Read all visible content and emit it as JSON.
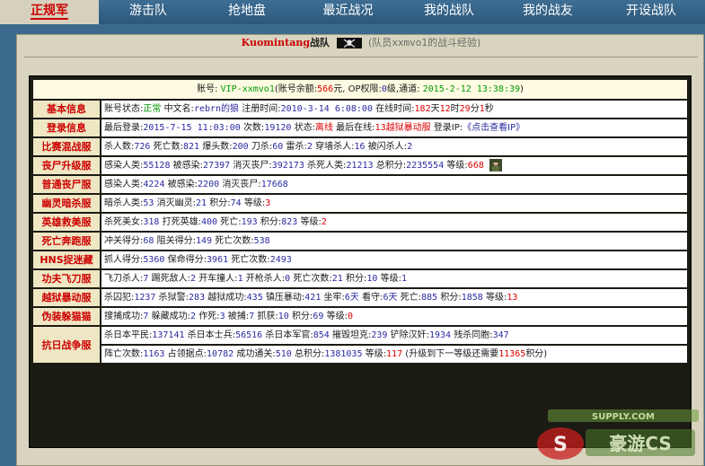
{
  "nav": {
    "items": [
      {
        "label": "正规军",
        "active": true
      },
      {
        "label": "游击队",
        "active": false
      },
      {
        "label": "抢地盘",
        "active": false
      },
      {
        "label": "最近战况",
        "active": false
      },
      {
        "label": "我的战队",
        "active": false
      },
      {
        "label": "我的战友",
        "active": false
      },
      {
        "label": "开设战队",
        "active": false
      }
    ]
  },
  "header": {
    "clan_name": "Kuomintang",
    "clan_suffix": "战队",
    "flag_icon": "skull-flag-icon",
    "member_prefix": "(队员",
    "member_name": "xxmvo1",
    "member_suffix": "的战斗经验)"
  },
  "account": {
    "label": "账号:",
    "id": "VIP-xxmvo1",
    "balance_label": "(账号余额:",
    "balance": "566",
    "balance_unit": "元,",
    "op_label": "OP权限:",
    "op_level": "0",
    "op_unit": "级,通道:",
    "datetime": "2015-2-12 13:38:39",
    "close": ")"
  },
  "rows": {
    "basic": {
      "title": "基本信息",
      "status_label": "账号状态:",
      "status": "正常",
      "cn_name_label": "中文名:",
      "cn_name": "rebrn的狼",
      "reg_label": "注册时间:",
      "reg_time": "2010-3-14 6:08:00",
      "online_label": "在线时间:",
      "days": "182",
      "days_unit": "天",
      "hours": "12",
      "hours_unit": "时",
      "mins": "29",
      "mins_unit": "分",
      "secs": "1",
      "secs_unit": "秒"
    },
    "login": {
      "title": "登录信息",
      "last_login_label": "最后登录:",
      "last_login": "2015-7-15 11:03:00",
      "count_label": "次数:",
      "count": "19120",
      "state_label": "状态:",
      "state": "离线",
      "last_online_label": "最后在线:",
      "last_online": "13越狱暴动服",
      "ip_label": "登录IP:",
      "ip_link": "《点击查看IP》"
    },
    "mix": {
      "title": "比赛混战服",
      "kills_label": "杀人数:",
      "kills": "726",
      "deaths_label": "死亡数:",
      "deaths": "821",
      "hs_label": "爆头数:",
      "hs": "200",
      "knife_label": "刀杀:",
      "knife": "60",
      "grenade_label": "雷杀:",
      "grenade": "2",
      "wall_label": "穿墙杀人:",
      "wall": "16",
      "flash_label": "被闪杀人:",
      "flash": "2"
    },
    "zombie_up": {
      "title": "丧尸升级服",
      "infect_label": "感染人类:",
      "infect": "55128",
      "infected_label": "被感染:",
      "infected": "27397",
      "destroy_label": "消灭丧尸:",
      "destroy": "392173",
      "killhuman_label": "杀死人类:",
      "killhuman": "21213",
      "score_label": "总积分:",
      "score": "2235554",
      "level_label": "等级:",
      "level": "668",
      "rank_icon": "soldier-rank-icon"
    },
    "zombie_normal": {
      "title": "普通丧尸服",
      "infect_label": "感染人类:",
      "infect": "4224",
      "infected_label": "被感染:",
      "infected": "2200",
      "destroy_label": "消灭丧尸:",
      "destroy": "17668"
    },
    "ghost": {
      "title": "幽灵暗杀服",
      "assassin_label": "暗杀人类:",
      "assassin": "53",
      "killghost_label": "消灭幽灵:",
      "killghost": "21",
      "score_label": "积分:",
      "score": "74",
      "level_label": "等级:",
      "level": "3"
    },
    "hero": {
      "title": "英雄救美服",
      "kill_beauty_label": "杀死美女:",
      "kill_beauty": "318",
      "kill_hero_label": "打死英雄:",
      "kill_hero": "400",
      "death_label": "死亡:",
      "death": "193",
      "score_label": "积分:",
      "score": "823",
      "level_label": "等级:",
      "level": "2"
    },
    "death_run": {
      "title": "死亡奔跑服",
      "rush_label": "冲关得分:",
      "rush": "68",
      "block_label": "阻关得分:",
      "block": "149",
      "death_label": "死亡次数:",
      "death": "538"
    },
    "hns": {
      "title": "HNS捉迷藏",
      "catch_label": "抓人得分:",
      "catch": "5360",
      "save_label": "保命得分:",
      "save": "3961",
      "death_label": "死亡次数:",
      "death": "2493"
    },
    "kungfu": {
      "title": "功夫飞刀服",
      "knife_label": "飞刀杀人:",
      "knife": "7",
      "kick_label": "踢死敌人:",
      "kick": "2",
      "car_label": "开车撞人:",
      "car": "1",
      "gun_label": "开枪杀人:",
      "gun": "0",
      "death_label": "死亡次数:",
      "death": "21",
      "score_label": "积分:",
      "score": "10",
      "level_label": "等级:",
      "level": "1"
    },
    "jail": {
      "title": "越狱暴动服",
      "kill_prisoner_label": "杀囚犯:",
      "kill_prisoner": "1237",
      "kill_guard_label": "杀狱警:",
      "kill_guard": "283",
      "escape_label": "越狱成功:",
      "escape": "435",
      "suppress_label": "镇压暴动:",
      "suppress": "421",
      "jail_label": "坐牢:",
      "jail_days": "6天",
      "guard_label": "看守:",
      "guard_days": "6天",
      "death_label": "死亡:",
      "death": "885",
      "score_label": "积分:",
      "score": "1858",
      "level_label": "等级:",
      "level": "13"
    },
    "camo": {
      "title": "伪装躲猫猫",
      "catch_label": "搜捕成功:",
      "catch": "7",
      "hide_label": "躲藏成功:",
      "hide": "2",
      "act_label": "作死:",
      "act": "3",
      "caught_label": "被捕:",
      "caught": "7",
      "grab_label": "抓获:",
      "grab": "10",
      "score_label": "积分:",
      "score": "69",
      "level_label": "等级:",
      "level": "0"
    },
    "war": {
      "title": "抗日战争服",
      "civ_label": "杀日本平民:",
      "civ": "137141",
      "soldier_label": "杀日本士兵:",
      "soldier": "56516",
      "officer_label": "杀日本军官:",
      "officer": "854",
      "tank_label": "摧毁坦克:",
      "tank": "239",
      "traitor_label": "铲除汉奸:",
      "traitor": "1934",
      "ally_label": "残杀同胞:",
      "ally": "347",
      "death_label": "阵亡次数:",
      "death": "1163",
      "capture_label": "占领据点:",
      "capture": "10782",
      "pass_label": "成功通关:",
      "pass": "510",
      "score_label": "总积分:",
      "score": "1381035",
      "level_label": "等级:",
      "level": "117",
      "next_prefix": "(升级到下一等级还需要",
      "next_value": "11365",
      "next_suffix": "积分)"
    }
  },
  "watermark": {
    "top_text": "SUPPLY.COM",
    "main_text": "豪游CS"
  },
  "colors": {
    "nav_bg": "#3e6e94",
    "panel_bg": "#d9d4bf",
    "accent_red": "#cc0000",
    "value_blue": "#2a2aa0",
    "status_green": "#009900"
  }
}
